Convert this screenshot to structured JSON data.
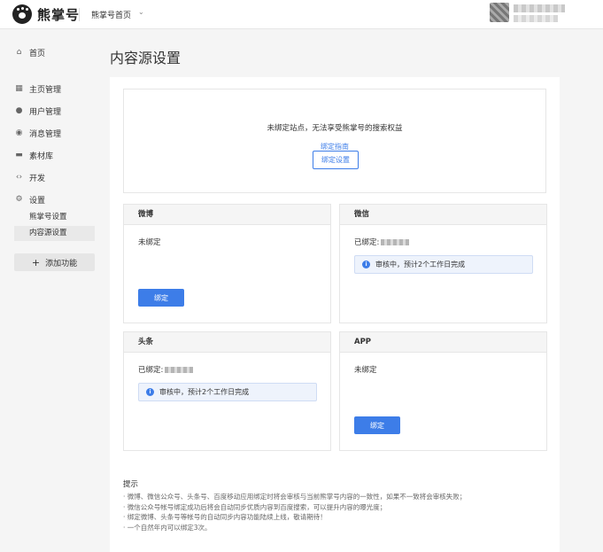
{
  "header": {
    "logo_text": "熊掌号",
    "nav_label": "熊掌号首页",
    "nav_caret": "⌄"
  },
  "sidebar": {
    "items": [
      {
        "label": "首页",
        "icon": "home-icon",
        "glyph": "⌂"
      },
      {
        "label": "主页管理",
        "icon": "grid-icon",
        "glyph": "▦"
      },
      {
        "label": "用户管理",
        "icon": "user-icon",
        "glyph": "●"
      },
      {
        "label": "消息管理",
        "icon": "message-icon",
        "glyph": "◉"
      },
      {
        "label": "素材库",
        "icon": "folder-icon",
        "glyph": "▬"
      },
      {
        "label": "开发",
        "icon": "code-icon",
        "glyph": "‹›"
      },
      {
        "label": "设置",
        "icon": "gear-icon",
        "glyph": "⚙"
      }
    ],
    "sub_items": [
      {
        "label": "熊掌号设置",
        "active": false
      },
      {
        "label": "内容源设置",
        "active": true
      }
    ],
    "add_button": {
      "plus": "+",
      "label": "添加功能"
    }
  },
  "main": {
    "title": "内容源设置",
    "top_box": {
      "message": "未绑定站点，无法享受熊掌号的搜索权益",
      "link": "绑定指南",
      "button": "绑定设置"
    },
    "cards": {
      "weibo": {
        "title": "微博",
        "status": "未绑定",
        "button": "绑定"
      },
      "wechat": {
        "title": "微信",
        "status": "已绑定:",
        "notice": "审核中，预计2个工作日完成"
      },
      "toutiao": {
        "title": "头条",
        "status": "已绑定:",
        "notice": "审核中，预计2个工作日完成"
      },
      "app": {
        "title": "APP",
        "status": "未绑定",
        "button": "绑定"
      }
    },
    "tips": {
      "title": "提示",
      "lines": [
        "· 微博、微信公众号、头条号、百度移动应用绑定时将会审核与当前熊掌号内容的一致性，如果不一致将会审核失败；",
        "· 微信公众号帐号绑定成功后将会自动同步优质内容到百度搜索，可以提升内容的曝光度；",
        "· 绑定微博、头条号等帐号的自动同步内容功能陆续上线，敬请期待！",
        "· 一个自然年内可以绑定3次。"
      ]
    }
  },
  "colors": {
    "accent": "#3d7de8",
    "notice_bg": "#eef3fc"
  }
}
